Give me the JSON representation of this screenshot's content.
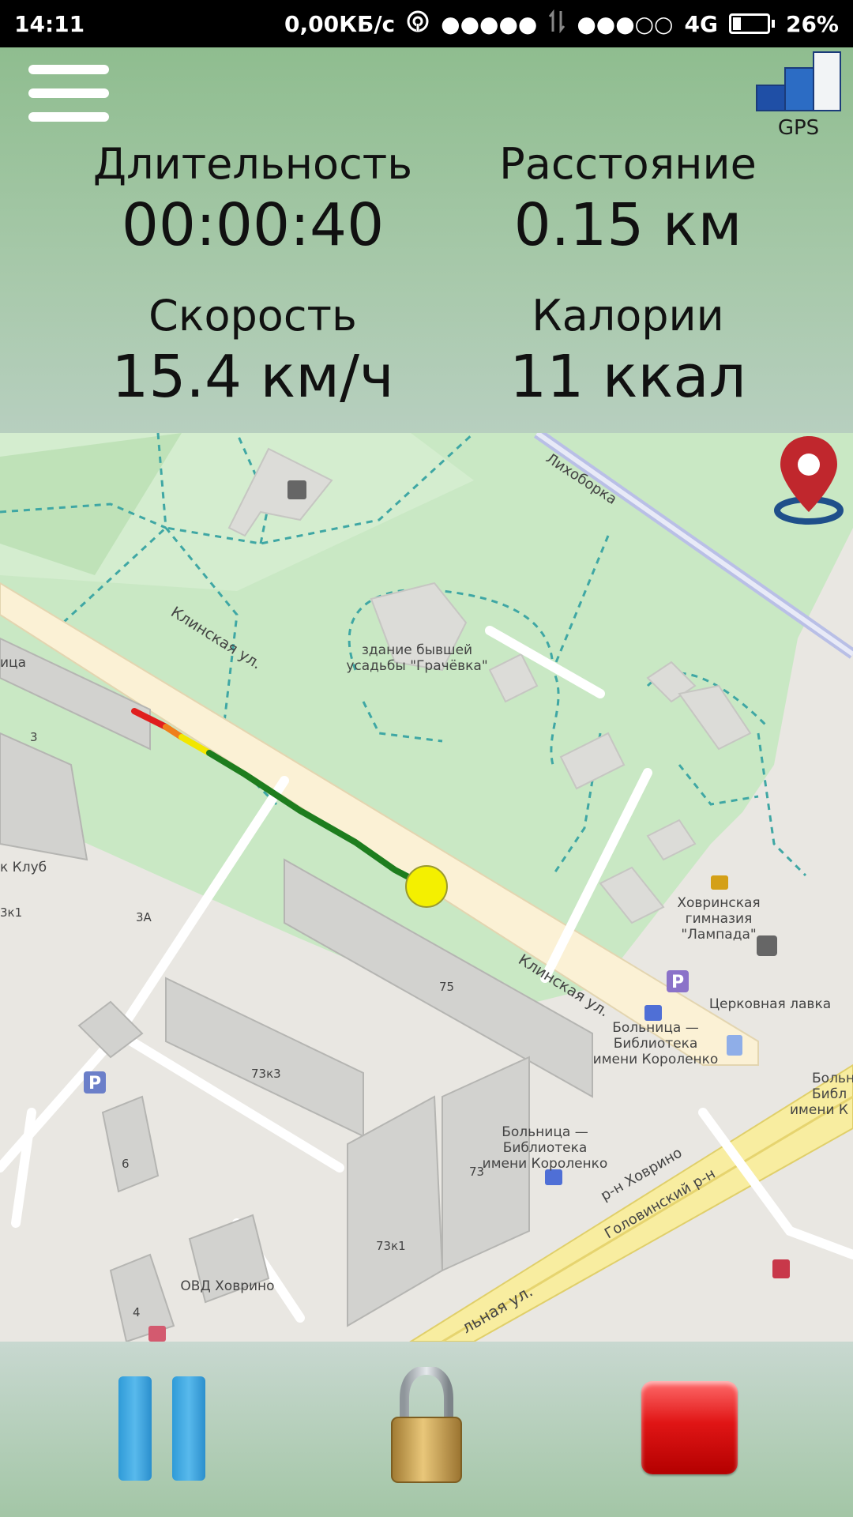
{
  "status_bar": {
    "time": "14:11",
    "net_speed": "0,00КБ/с",
    "signal_a": "●●●●●",
    "signal_b": "●●●○○",
    "network": "4G",
    "battery": "26%"
  },
  "header": {
    "gps_label": "GPS",
    "stats": {
      "duration": {
        "label": "Длительность",
        "value": "00:00:40"
      },
      "distance": {
        "label": "Расстояние",
        "value": "0.15 км"
      },
      "speed": {
        "label": "Скорость",
        "value": "15.4 км/ч"
      },
      "calories": {
        "label": "Калории",
        "value": "11 ккал"
      }
    }
  },
  "map": {
    "labels": {
      "ligovka": "Лихоборка",
      "estate_1": "здание бывшей",
      "estate_2": "усадьбы \"Грачёвка\"",
      "street_1": "Клинская ул.",
      "street_2": "Клинская ул.",
      "gym_1": "Ховринская",
      "gym_2": "гимназия",
      "gym_3": "\"Лампада\"",
      "church_shop": "Церковная лавка",
      "hosp_a1": "Больница —",
      "hosp_a2": "Библиотека",
      "hosp_a3": "имени Короленко",
      "hosp_b1": "Больница —",
      "hosp_b2": "Библиотека",
      "hosp_b3": "имени Короленко",
      "hosp_c1": "Больн",
      "hosp_c2": "Библ",
      "hosp_c3": "имени К",
      "district_1": "р-н Ховрино",
      "district_2": "Головинский р-н",
      "police": "ОВД Ховрино",
      "street_3": "льная ул.",
      "club": "к Клуб",
      "b_3": "3",
      "b_3a": "3А",
      "b_3k1": "3к1",
      "b_75": "75",
      "b_73k3": "73к3",
      "b_73": "73",
      "b_73k1": "73к1",
      "b_6": "6",
      "b_4": "4",
      "edge_cut": "ица"
    },
    "route_colors": {
      "start": "#e01e1e",
      "mid": "#f2b400",
      "main": "#1e7d1e"
    },
    "marker_color": "#f4f000"
  },
  "controls": {
    "pause": "pause-icon",
    "lock": "lock-icon",
    "stop": "stop-icon"
  }
}
